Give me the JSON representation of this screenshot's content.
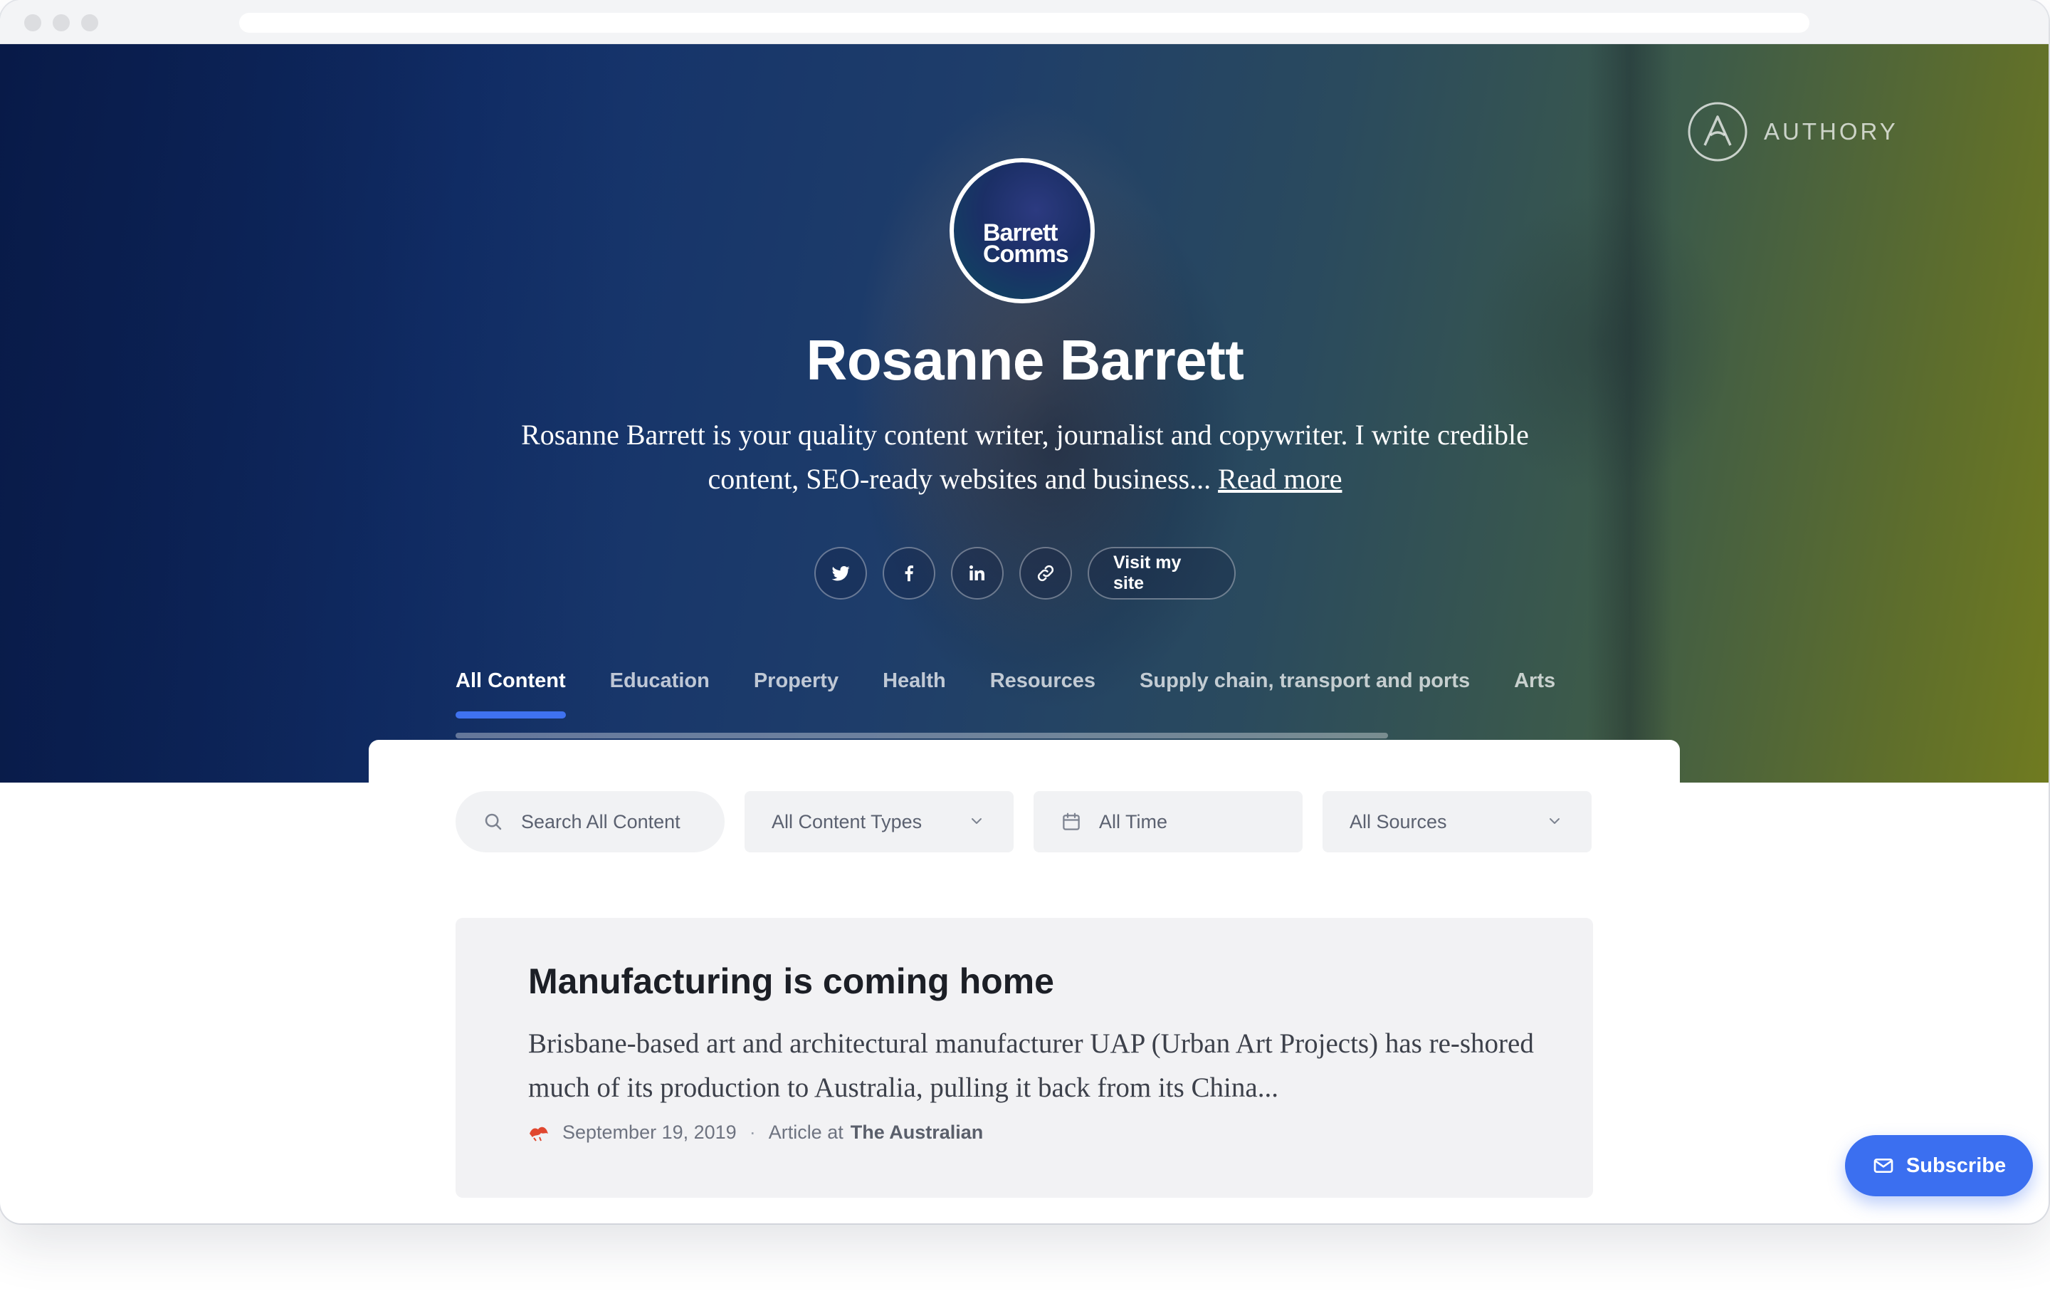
{
  "window": {
    "controls": [
      "close",
      "minimize",
      "maximize"
    ]
  },
  "brand": {
    "name": "AUTHORY",
    "icon": "authory-logo-icon"
  },
  "profile": {
    "avatar_lines": [
      "Barrett",
      "Comms"
    ],
    "name": "Rosanne Barrett",
    "bio": "Rosanne Barrett is your quality content writer, journalist and copywriter. I write credible content, SEO-ready websites and business...",
    "read_more": "Read more",
    "socials": [
      {
        "icon": "twitter-icon"
      },
      {
        "icon": "facebook-icon"
      },
      {
        "icon": "linkedin-icon"
      },
      {
        "icon": "link-icon"
      }
    ],
    "visit_label": "Visit my site"
  },
  "tabs": [
    {
      "label": "All Content",
      "active": true
    },
    {
      "label": "Education"
    },
    {
      "label": "Property"
    },
    {
      "label": "Health"
    },
    {
      "label": "Resources"
    },
    {
      "label": "Supply chain, transport and ports"
    },
    {
      "label": "Arts"
    }
  ],
  "filters": {
    "search_placeholder": "Search All Content",
    "content_types": "All Content Types",
    "time": "All Time",
    "sources": "All Sources"
  },
  "articles": [
    {
      "title": "Manufacturing is coming home",
      "excerpt": "Brisbane-based art and architectural manufacturer UAP (Urban Art Projects) has re-shored much of its production to Australia, pulling it back from its China...",
      "date": "September 19, 2019",
      "separator": "·",
      "type_prefix": "Article at",
      "source": "The Australian",
      "source_icon": "the-australian-logo-icon"
    }
  ],
  "subscribe_label": "Subscribe",
  "colors": {
    "accent": "#3b6ff0",
    "hero_blue": "#0b2257",
    "hero_olive": "#707b20",
    "card_bg": "#f2f2f4"
  }
}
